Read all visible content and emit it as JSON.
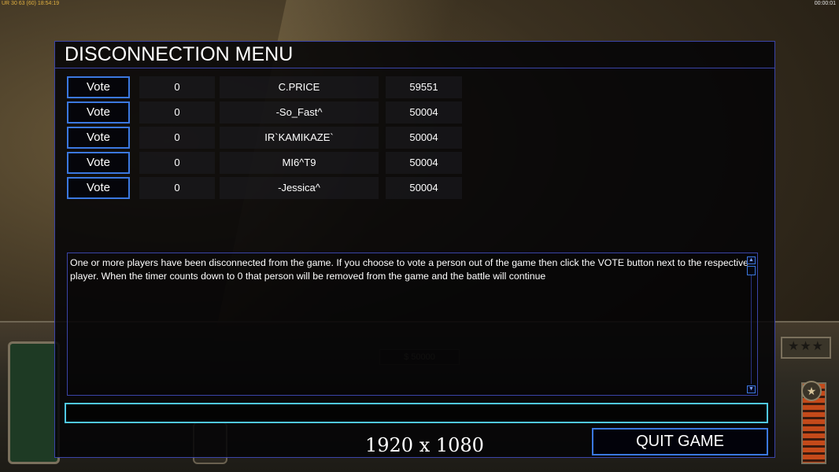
{
  "topbar": {
    "left_text": "UR 30 63 (60) 18:54:19",
    "right_text": "00:00:01"
  },
  "hud": {
    "money_text": "$ 50000",
    "rank_stars": "★★★"
  },
  "panel": {
    "title": "DISCONNECTION MENU"
  },
  "players": [
    {
      "vote_label": "Vote",
      "count": "0",
      "name": "C.PRICE",
      "ping": "59551"
    },
    {
      "vote_label": "Vote",
      "count": "0",
      "name": "-So_Fast^",
      "ping": "50004"
    },
    {
      "vote_label": "Vote",
      "count": "0",
      "name": "IR`KAMIKAZE`",
      "ping": "50004"
    },
    {
      "vote_label": "Vote",
      "count": "0",
      "name": "MI6^T9",
      "ping": "50004"
    },
    {
      "vote_label": "Vote",
      "count": "0",
      "name": "-Jessica^",
      "ping": "50004"
    }
  ],
  "message": {
    "text": "One or more players have been disconnected from the game. If you choose to vote a person out of the game then click the VOTE button next to the respective player. When the timer counts down to 0 that person will be removed from the game and the battle will continue"
  },
  "chat_input": {
    "value": ""
  },
  "quit_button_label": "QUIT GAME",
  "resolution_overlay": "1920 x 1080",
  "colors": {
    "panel_border": "#3a44a8",
    "button_border": "#3b78e0",
    "input_border": "#4fc8e8"
  }
}
